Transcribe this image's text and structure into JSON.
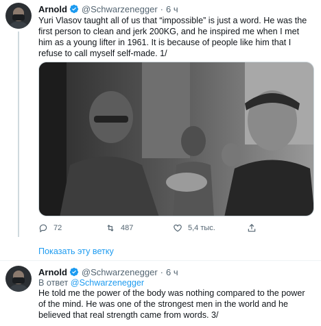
{
  "tweets": [
    {
      "author": {
        "name": "Arnold",
        "handle": "@Schwarzenegger",
        "time": "6 ч"
      },
      "text": "Yuri Vlasov taught all of us that “impossible” is just a word. He was the first person to clean and jerk 200KG, and he inspired me when I met him as a young lifter in 1961. It is because of people like him that I refuse to call myself self-made. 1/",
      "actions": {
        "reply_count": "72",
        "retweet_count": "487",
        "like_count": "5,4 тыс."
      }
    },
    {
      "author": {
        "name": "Arnold",
        "handle": "@Schwarzenegger",
        "time": "6 ч"
      },
      "reply_prefix": "В ответ",
      "reply_to": "@Schwarzenegger",
      "text": "He told me the power of the body was nothing compared to the power of the mind. He was one of the strongest men in the world and he believed that real strength came from words. 3/"
    }
  ],
  "show_thread": "Показать эту ветку",
  "header_separator": "·",
  "colors": {
    "link": "#1d9bf0",
    "secondary": "#536471",
    "verified": "#1d9bf0"
  },
  "icons": [
    "verified-badge-icon",
    "reply-icon",
    "retweet-icon",
    "like-icon",
    "share-icon"
  ]
}
